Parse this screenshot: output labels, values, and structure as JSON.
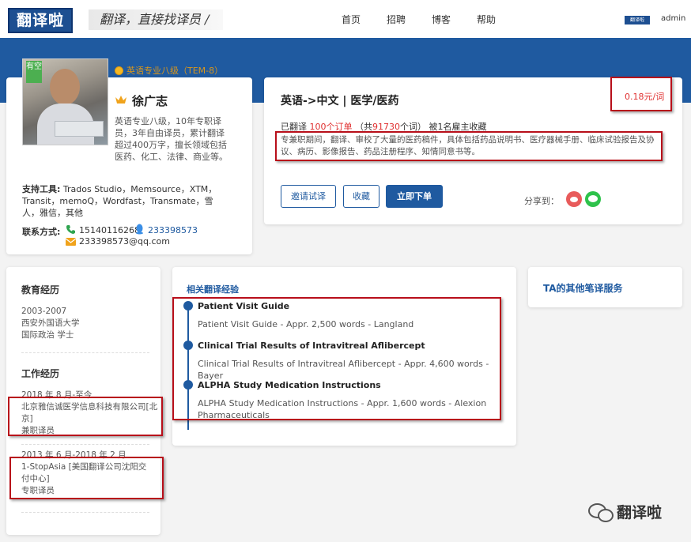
{
  "header": {
    "logo_text": "翻译啦",
    "slogan": "翻译，直接找译员 /",
    "nav": [
      "首页",
      "招聘",
      "博客",
      "帮助"
    ],
    "mini_logo": "翻译啦",
    "user": "admin"
  },
  "profile": {
    "status_tag": "有空",
    "level_badge": "英语专业八级（TEM-8）",
    "name": "徐广志",
    "bio": "英语专业八级，10年专职译员，3年自由译员，累计翻译超过400万字，擅长领域包括医药、化工、法律、商业等。",
    "tools_label": "支持工具:",
    "tools": "Trados Studio，Memsource，XTM，Transit，memoQ，Wordfast，Transmate，雪人，雅信，其他",
    "contact_label": "联系方式:",
    "phone": "15140116268",
    "qq": "233398573",
    "email": "233398573@qq.com"
  },
  "service": {
    "title": "英语->中文 | 医学/医药",
    "price": "0.18元/词",
    "stats_prefix": "已翻译 ",
    "orders": "100个订单",
    "words_prefix": "（共",
    "words": "91730",
    "words_suffix": "个词）",
    "favorites": "被1名雇主收藏",
    "description": "专兼职期间，翻译、审校了大量的医药稿件，具体包括药品说明书、医疗器械手册、临床试验报告及协议、病历、影像报告、药品注册程序、知情同意书等。",
    "btn_invite": "邀请试译",
    "btn_fav": "收藏",
    "btn_order": "立即下单",
    "share_label": "分享到："
  },
  "resume": {
    "edu_title": "教育经历",
    "edu": {
      "years": "2003-2007",
      "school": "西安外国语大学",
      "major": "国际政治 学士"
    },
    "work_title": "工作经历",
    "work": [
      {
        "period": "2018 年 8 月-至今",
        "company": "北京雅信诚医学信息科技有限公司[北京]",
        "role": "兼职译员"
      },
      {
        "period": "2013 年 6 月-2018 年 2 月",
        "company": "1-StopAsia [美国翻译公司沈阳交付中心]",
        "role": "专职译员"
      }
    ]
  },
  "experience": {
    "title": "相关翻译经验",
    "items": [
      {
        "name": "Patient Visit Guide",
        "detail": "Patient Visit Guide - Appr. 2,500 words - Langland"
      },
      {
        "name": "Clinical Trial Results of Intravitreal Aflibercept",
        "detail": "Clinical Trial Results of Intravitreal Aflibercept - Appr. 4,600 words - Bayer"
      },
      {
        "name": "ALPHA Study Medication Instructions",
        "detail": "ALPHA Study Medication Instructions - Appr. 1,600 words - Alexion Pharmaceuticals"
      }
    ]
  },
  "other_services": {
    "title": "TA的其他笔译服务"
  },
  "watermark": "翻译啦",
  "colors": {
    "brand": "#1f5aa0",
    "price": "#e03030",
    "highlight": "#b80f1a",
    "available": "#4caf50"
  }
}
